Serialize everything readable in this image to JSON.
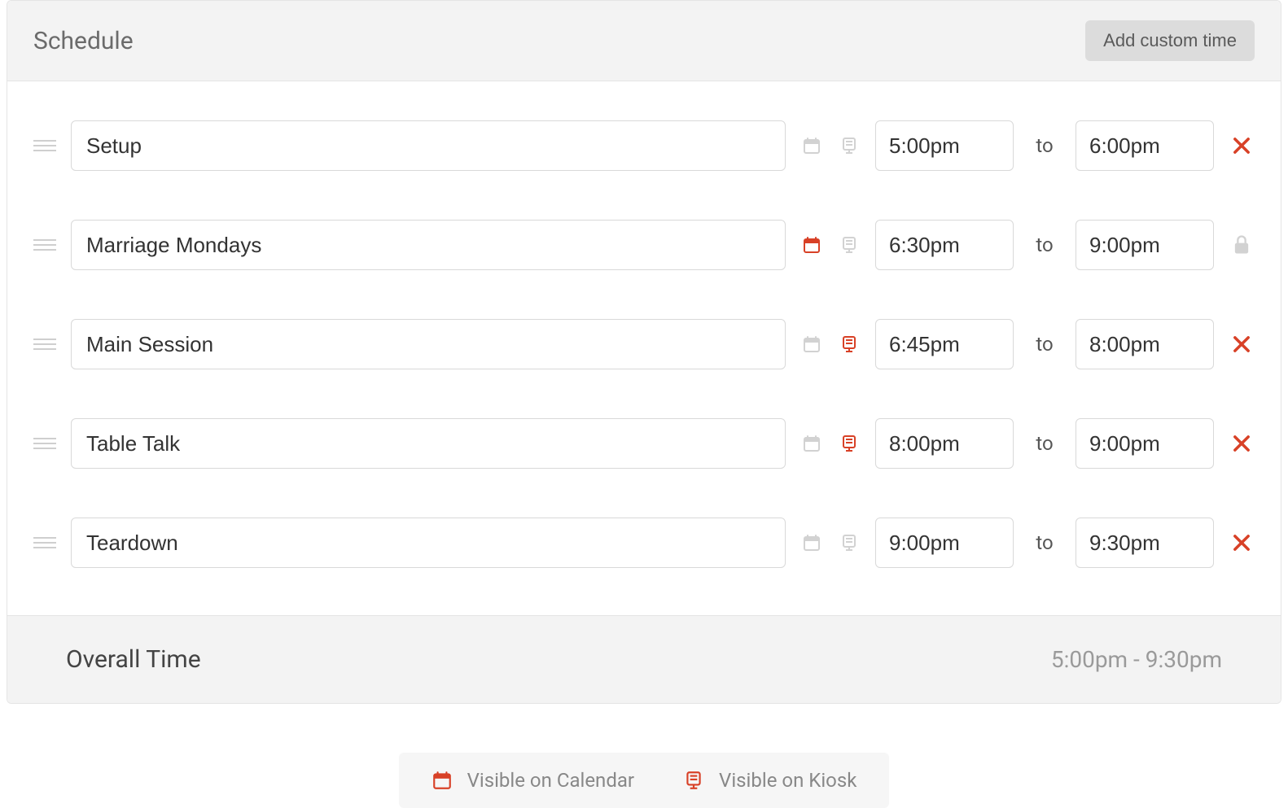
{
  "header": {
    "title": "Schedule",
    "add_button": "Add custom time"
  },
  "to_label": "to",
  "rows": [
    {
      "name": "Setup",
      "calendar_active": false,
      "kiosk_active": false,
      "start": "5:00pm",
      "end": "6:00pm",
      "locked": false
    },
    {
      "name": "Marriage Mondays",
      "calendar_active": true,
      "kiosk_active": false,
      "start": "6:30pm",
      "end": "9:00pm",
      "locked": true
    },
    {
      "name": "Main Session",
      "calendar_active": false,
      "kiosk_active": true,
      "start": "6:45pm",
      "end": "8:00pm",
      "locked": false
    },
    {
      "name": "Table Talk",
      "calendar_active": false,
      "kiosk_active": true,
      "start": "8:00pm",
      "end": "9:00pm",
      "locked": false
    },
    {
      "name": "Teardown",
      "calendar_active": false,
      "kiosk_active": false,
      "start": "9:00pm",
      "end": "9:30pm",
      "locked": false
    }
  ],
  "footer": {
    "label": "Overall Time",
    "range": "5:00pm - 9:30pm"
  },
  "legend": {
    "calendar": "Visible on Calendar",
    "kiosk": "Visible on Kiosk"
  }
}
